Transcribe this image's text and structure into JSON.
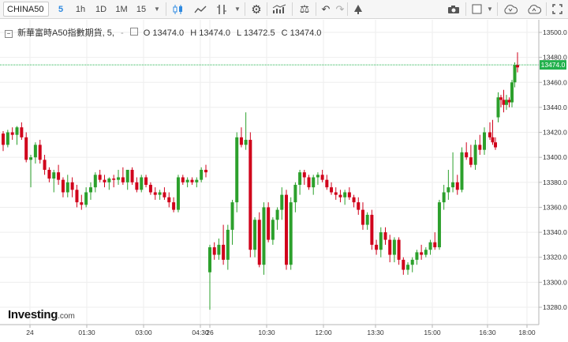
{
  "toolbar": {
    "symbol": "CHINA50",
    "intervals": [
      "5",
      "1h",
      "1D",
      "1M",
      "15"
    ],
    "active_interval": "5",
    "icons": [
      "candle-icon",
      "line-chart-icon",
      "indicator-icon",
      "gear-icon",
      "studies-icon",
      "balance-icon",
      "undo-icon",
      "redo-icon",
      "drawing-icon",
      "camera-icon",
      "template-icon",
      "cloud-download-icon",
      "cloud-upload-icon",
      "fullscreen-icon"
    ]
  },
  "legend": {
    "title": "新華富時A50指數期貨, 5,",
    "separator": "-",
    "open": "O 13474.0",
    "high": "H 13474.0",
    "low": "L 13472.5",
    "close": "C 13474.0"
  },
  "logo": {
    "brand": "Investing",
    "domain": ".com"
  },
  "colors": {
    "up": "#2ca02c",
    "down": "#d0021b",
    "last_price_line": "#23b14d",
    "grid": "#eeeeee"
  },
  "chart_data": {
    "type": "candlestick",
    "title": "新華富時A50指數期貨, 5,",
    "ylim": [
      13272,
      13510
    ],
    "y_ticks": [
      "13280.0",
      "13300.0",
      "13320.0",
      "13340.0",
      "13360.0",
      "13380.0",
      "13400.0",
      "13420.0",
      "13440.0",
      "13460.0",
      "13480.0",
      "13500.0"
    ],
    "x_ticks": [
      "24",
      "01:30",
      "03:00",
      "04:30",
      "26",
      "10:30",
      "12:00",
      "13:30",
      "15:00",
      "16:30",
      "18:00"
    ],
    "last_price": "13474.0",
    "grid": true,
    "candles": [
      [
        13419,
        13421,
        13405,
        13410
      ],
      [
        13410,
        13422,
        13408,
        13420
      ],
      [
        13420,
        13424,
        13414,
        13418
      ],
      [
        13418,
        13425,
        13410,
        13424
      ],
      [
        13424,
        13428,
        13414,
        13416
      ],
      [
        13416,
        13420,
        13396,
        13398
      ],
      [
        13398,
        13402,
        13376,
        13400
      ],
      [
        13400,
        13412,
        13395,
        13410
      ],
      [
        13410,
        13414,
        13395,
        13398
      ],
      [
        13398,
        13402,
        13386,
        13390
      ],
      [
        13390,
        13392,
        13380,
        13383
      ],
      [
        13383,
        13390,
        13372,
        13388
      ],
      [
        13388,
        13394,
        13378,
        13382
      ],
      [
        13382,
        13384,
        13368,
        13372
      ],
      [
        13372,
        13386,
        13368,
        13380
      ],
      [
        13380,
        13384,
        13368,
        13374
      ],
      [
        13374,
        13378,
        13360,
        13364
      ],
      [
        13364,
        13370,
        13358,
        13362
      ],
      [
        13362,
        13376,
        13360,
        13372
      ],
      [
        13372,
        13380,
        13366,
        13376
      ],
      [
        13376,
        13388,
        13372,
        13386
      ],
      [
        13386,
        13390,
        13380,
        13382
      ],
      [
        13382,
        13386,
        13376,
        13380
      ],
      [
        13380,
        13384,
        13374,
        13383
      ],
      [
        13383,
        13386,
        13376,
        13382
      ],
      [
        13382,
        13390,
        13378,
        13384
      ],
      [
        13384,
        13392,
        13378,
        13380
      ],
      [
        13380,
        13390,
        13374,
        13390
      ],
      [
        13390,
        13392,
        13378,
        13380
      ],
      [
        13380,
        13384,
        13372,
        13374
      ],
      [
        13374,
        13386,
        13372,
        13384
      ],
      [
        13384,
        13386,
        13376,
        13378
      ],
      [
        13378,
        13380,
        13370,
        13372
      ],
      [
        13372,
        13376,
        13366,
        13370
      ],
      [
        13370,
        13374,
        13366,
        13372
      ],
      [
        13372,
        13376,
        13366,
        13368
      ],
      [
        13368,
        13372,
        13360,
        13364
      ],
      [
        13364,
        13368,
        13356,
        13358
      ],
      [
        13358,
        13386,
        13356,
        13384
      ],
      [
        13384,
        13386,
        13378,
        13380
      ],
      [
        13380,
        13384,
        13376,
        13382
      ],
      [
        13382,
        13384,
        13378,
        13380
      ],
      [
        13380,
        13384,
        13376,
        13382
      ],
      [
        13382,
        13392,
        13380,
        13390
      ],
      [
        13390,
        13394,
        13384,
        13388
      ],
      [
        13308,
        13330,
        13278,
        13328
      ],
      [
        13328,
        13332,
        13318,
        13322
      ],
      [
        13322,
        13335,
        13318,
        13330
      ],
      [
        13330,
        13346,
        13314,
        13318
      ],
      [
        13318,
        13346,
        13310,
        13342
      ],
      [
        13342,
        13366,
        13330,
        13364
      ],
      [
        13364,
        13420,
        13356,
        13416
      ],
      [
        13416,
        13424,
        13408,
        13410
      ],
      [
        13410,
        13436,
        13406,
        13414
      ],
      [
        13414,
        13420,
        13320,
        13326
      ],
      [
        13326,
        13352,
        13320,
        13350
      ],
      [
        13350,
        13356,
        13312,
        13314
      ],
      [
        13314,
        13364,
        13306,
        13360
      ],
      [
        13360,
        13364,
        13332,
        13334
      ],
      [
        13334,
        13352,
        13330,
        13350
      ],
      [
        13350,
        13360,
        13342,
        13358
      ],
      [
        13358,
        13376,
        13350,
        13370
      ],
      [
        13370,
        13374,
        13310,
        13314
      ],
      [
        13314,
        13368,
        13310,
        13364
      ],
      [
        13364,
        13380,
        13356,
        13378
      ],
      [
        13378,
        13390,
        13370,
        13388
      ],
      [
        13388,
        13390,
        13378,
        13384
      ],
      [
        13384,
        13386,
        13374,
        13376
      ],
      [
        13376,
        13386,
        13370,
        13384
      ],
      [
        13384,
        13388,
        13378,
        13386
      ],
      [
        13386,
        13390,
        13380,
        13382
      ],
      [
        13382,
        13386,
        13374,
        13376
      ],
      [
        13376,
        13380,
        13370,
        13372
      ],
      [
        13372,
        13376,
        13366,
        13370
      ],
      [
        13370,
        13374,
        13364,
        13368
      ],
      [
        13368,
        13374,
        13362,
        13372
      ],
      [
        13372,
        13376,
        13366,
        13368
      ],
      [
        13368,
        13370,
        13360,
        13364
      ],
      [
        13364,
        13368,
        13354,
        13358
      ],
      [
        13358,
        13364,
        13342,
        13346
      ],
      [
        13346,
        13356,
        13342,
        13354
      ],
      [
        13354,
        13358,
        13326,
        13330
      ],
      [
        13330,
        13334,
        13322,
        13326
      ],
      [
        13326,
        13344,
        13320,
        13340
      ],
      [
        13340,
        13344,
        13330,
        13334
      ],
      [
        13334,
        13338,
        13316,
        13322
      ],
      [
        13322,
        13336,
        13316,
        13334
      ],
      [
        13334,
        13336,
        13314,
        13318
      ],
      [
        13318,
        13320,
        13306,
        13310
      ],
      [
        13310,
        13316,
        13306,
        13314
      ],
      [
        13314,
        13320,
        13308,
        13318
      ],
      [
        13318,
        13326,
        13314,
        13324
      ],
      [
        13324,
        13330,
        13318,
        13322
      ],
      [
        13322,
        13328,
        13320,
        13326
      ],
      [
        13326,
        13334,
        13322,
        13332
      ],
      [
        13332,
        13340,
        13326,
        13328
      ],
      [
        13328,
        13366,
        13326,
        13364
      ],
      [
        13364,
        13378,
        13358,
        13372
      ],
      [
        13372,
        13390,
        13366,
        13376
      ],
      [
        13376,
        13404,
        13372,
        13380
      ],
      [
        13380,
        13386,
        13370,
        13374
      ],
      [
        13374,
        13408,
        13372,
        13404
      ],
      [
        13404,
        13412,
        13398,
        13400
      ],
      [
        13400,
        13410,
        13392,
        13394
      ],
      [
        13394,
        13414,
        13390,
        13410
      ],
      [
        13410,
        13418,
        13402,
        13406
      ],
      [
        13406,
        13424,
        13402,
        13420
      ],
      [
        13420,
        13428,
        13414,
        13416
      ],
      [
        13416,
        13430,
        13410,
        13412
      ],
      [
        13412,
        13416,
        13406,
        13408
      ],
      [
        13432,
        13452,
        13428,
        13448
      ],
      [
        13448,
        13450,
        13440,
        13446
      ],
      [
        13446,
        13454,
        13436,
        13442
      ],
      [
        13442,
        13450,
        13438,
        13446
      ],
      [
        13446,
        13448,
        13440,
        13444
      ],
      [
        13444,
        13462,
        13440,
        13460
      ],
      [
        13460,
        13476,
        13456,
        13474
      ],
      [
        13474,
        13484,
        13468,
        13472
      ]
    ]
  }
}
